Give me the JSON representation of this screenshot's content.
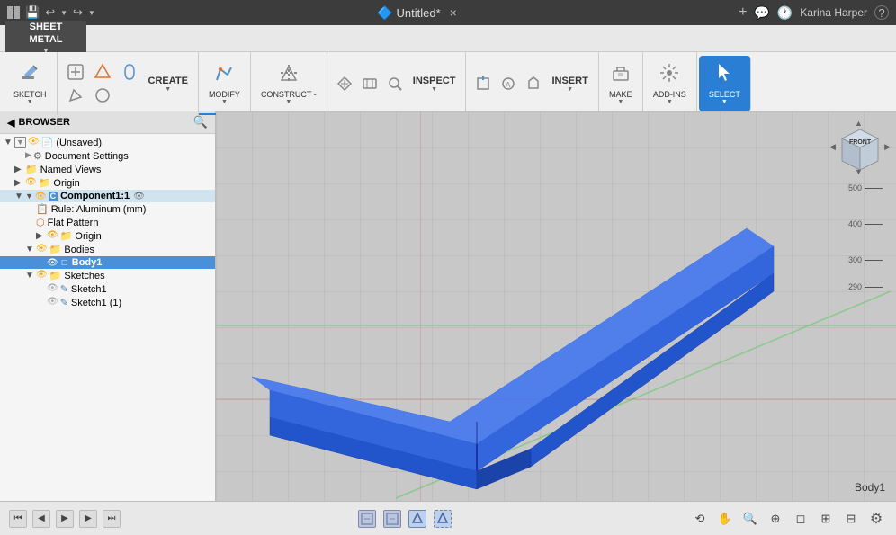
{
  "app": {
    "title": "Untitled*",
    "user": "Karina Harper"
  },
  "titlebar": {
    "grid_icon": "grid-icon",
    "title": "Untitled*",
    "close_label": "×",
    "new_tab_label": "+",
    "user_label": "Karina Harper",
    "help_label": "?"
  },
  "sheet_metal": {
    "line1": "SHEET",
    "line2": "METAL"
  },
  "toolbar": {
    "undo_label": "↩",
    "redo_label": "↪",
    "groups": [
      {
        "id": "sketch",
        "label": "SKETCH",
        "has_dropdown": true
      },
      {
        "id": "create",
        "label": "CREATE",
        "has_dropdown": true
      },
      {
        "id": "modify",
        "label": "MODIFY",
        "has_dropdown": true,
        "active": true
      },
      {
        "id": "construct",
        "label": "CONSTRUCT -",
        "has_dropdown": true
      },
      {
        "id": "inspect",
        "label": "INSPECT",
        "has_dropdown": true
      },
      {
        "id": "insert",
        "label": "INSERT",
        "has_dropdown": true
      },
      {
        "id": "make",
        "label": "MAKE",
        "has_dropdown": true
      },
      {
        "id": "add_ins",
        "label": "ADD-INS",
        "has_dropdown": true
      },
      {
        "id": "select",
        "label": "SELECT",
        "has_dropdown": true,
        "highlight": true
      }
    ]
  },
  "browser": {
    "header": "BROWSER",
    "search_placeholder": "Search",
    "items": [
      {
        "id": "unsaved",
        "label": "(Unsaved)",
        "indent": 0,
        "type": "doc",
        "expanded": true
      },
      {
        "id": "doc_settings",
        "label": "Document Settings",
        "indent": 1,
        "type": "settings"
      },
      {
        "id": "named_views",
        "label": "Named Views",
        "indent": 1,
        "type": "folder"
      },
      {
        "id": "origin",
        "label": "Origin",
        "indent": 1,
        "type": "origin"
      },
      {
        "id": "component1",
        "label": "Component1:1",
        "indent": 1,
        "type": "component",
        "expanded": true,
        "selected": false
      },
      {
        "id": "rule",
        "label": "Rule: Aluminum (mm)",
        "indent": 2,
        "type": "rule"
      },
      {
        "id": "flat_pattern",
        "label": "Flat Pattern",
        "indent": 2,
        "type": "flat"
      },
      {
        "id": "comp_origin",
        "label": "Origin",
        "indent": 2,
        "type": "origin"
      },
      {
        "id": "bodies",
        "label": "Bodies",
        "indent": 2,
        "type": "folder",
        "expanded": true
      },
      {
        "id": "body1",
        "label": "Body1",
        "indent": 3,
        "type": "body",
        "selected": true
      },
      {
        "id": "sketches",
        "label": "Sketches",
        "indent": 2,
        "type": "folder",
        "expanded": true
      },
      {
        "id": "sketch1",
        "label": "Sketch1",
        "indent": 3,
        "type": "sketch"
      },
      {
        "id": "sketch1_1",
        "label": "Sketch1 (1)",
        "indent": 3,
        "type": "sketch"
      }
    ]
  },
  "viewport": {
    "body_label": "Body1",
    "view_label": "FRONT",
    "scale_marks": [
      "500",
      "400",
      "300",
      "290"
    ]
  },
  "statusbar": {
    "nav_buttons": [
      "◀◀",
      "◀",
      "▶",
      "▶▶",
      "▶|"
    ],
    "timeline_items": [
      "S",
      "S"
    ],
    "gear_icon": "⚙",
    "view_tools": [
      "↔",
      "✋",
      "🔍",
      "⊕",
      "◻",
      "⊞",
      "⊟"
    ]
  }
}
